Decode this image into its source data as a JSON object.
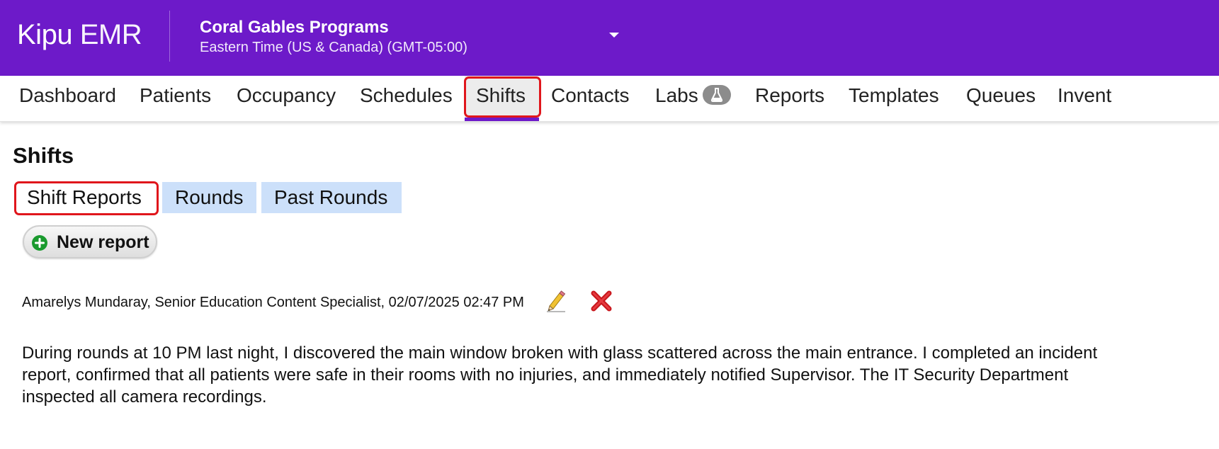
{
  "header": {
    "logo_brand": "Kipu",
    "logo_product": "EMR",
    "program_name": "Coral Gables Programs",
    "timezone": "Eastern Time (US & Canada) (GMT-05:00)",
    "brand_color": "#6d1ac9"
  },
  "nav": {
    "items": [
      {
        "label": "Dashboard"
      },
      {
        "label": "Patients"
      },
      {
        "label": "Occupancy"
      },
      {
        "label": "Schedules"
      },
      {
        "label": "Shifts",
        "active": true
      },
      {
        "label": "Contacts"
      },
      {
        "label": "Labs",
        "icon": "flask-icon"
      },
      {
        "label": "Reports"
      },
      {
        "label": "Templates"
      },
      {
        "label": "Queues"
      },
      {
        "label": "Invent"
      }
    ]
  },
  "page": {
    "title": "Shifts",
    "tabs": [
      {
        "label": "Shift Reports",
        "active": true
      },
      {
        "label": "Rounds"
      },
      {
        "label": "Past Rounds"
      }
    ],
    "new_report_label": "New report"
  },
  "report": {
    "meta": "Amarelys Mundaray, Senior Education Content Specialist, 02/07/2025 02:47 PM",
    "edit_icon": "pencil-icon",
    "delete_icon": "red-x-icon",
    "body": "During rounds at 10 PM last night, I discovered the main window broken with glass scattered across the main entrance. I completed an incident report, confirmed that all patients were safe in their rooms with no injuries, and immediately notified Supervisor. The IT Security Department inspected all camera recordings."
  }
}
